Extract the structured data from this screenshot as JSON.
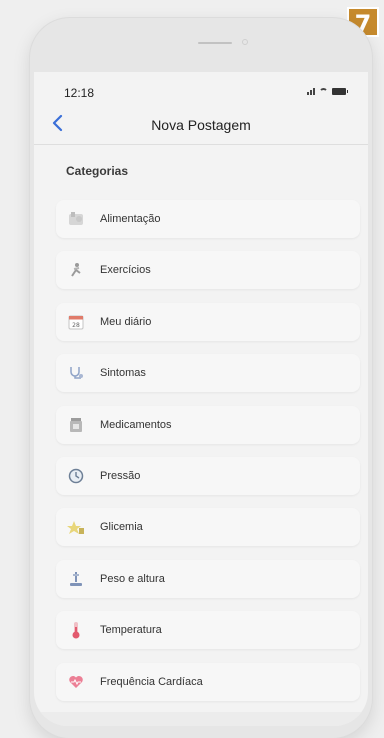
{
  "badge": "7",
  "status": {
    "time": "12:18"
  },
  "nav": {
    "back_icon": "chevron-left-icon",
    "title": "Nova Postagem"
  },
  "section": {
    "label": "Categorias"
  },
  "categories": [
    {
      "label": "Alimentação",
      "icon": "food-icon"
    },
    {
      "label": "Exercícios",
      "icon": "exercise-icon"
    },
    {
      "label": "Meu diário",
      "icon": "calendar-icon"
    },
    {
      "label": "Sintomas",
      "icon": "stethoscope-icon"
    },
    {
      "label": "Medicamentos",
      "icon": "pill-bottle-icon"
    },
    {
      "label": "Pressão",
      "icon": "clock-icon"
    },
    {
      "label": "Glicemia",
      "icon": "glucose-icon"
    },
    {
      "label": "Peso e altura",
      "icon": "scale-icon"
    },
    {
      "label": "Temperatura",
      "icon": "thermometer-icon"
    },
    {
      "label": "Frequência Cardíaca",
      "icon": "heart-icon"
    }
  ],
  "colors": {
    "accent": "#3a6fd8",
    "badge": "#c68a2d"
  }
}
